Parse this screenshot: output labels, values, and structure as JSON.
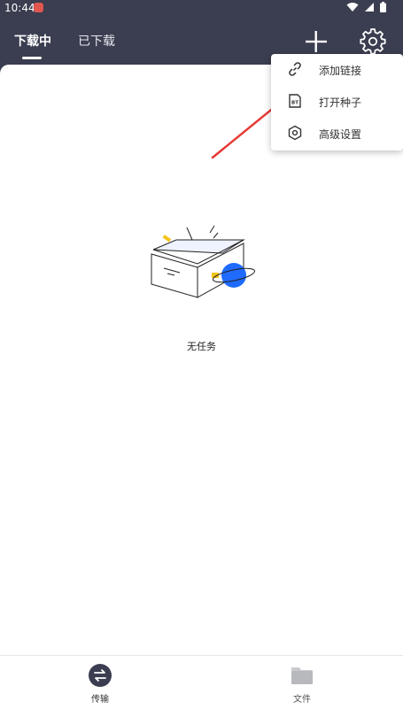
{
  "status_bar": {
    "time": "10:44"
  },
  "tabs": [
    {
      "label": "下载中",
      "active": true
    },
    {
      "label": "已下载",
      "active": false
    }
  ],
  "menu": {
    "items": [
      {
        "label": "添加链接",
        "icon": "link-icon"
      },
      {
        "label": "打开种子",
        "icon": "bt-icon",
        "icon_text": "BT"
      },
      {
        "label": "高级设置",
        "icon": "hexagon-settings-icon"
      }
    ]
  },
  "empty_state": {
    "text": "无任务"
  },
  "bottom_nav": [
    {
      "label": "传输",
      "icon": "transfer-icon",
      "active": true
    },
    {
      "label": "文件",
      "icon": "folder-icon",
      "active": false
    }
  ],
  "colors": {
    "header_bg": "#3b3e50",
    "accent_blue": "#1f6bff",
    "arrow_red": "#e53935"
  }
}
